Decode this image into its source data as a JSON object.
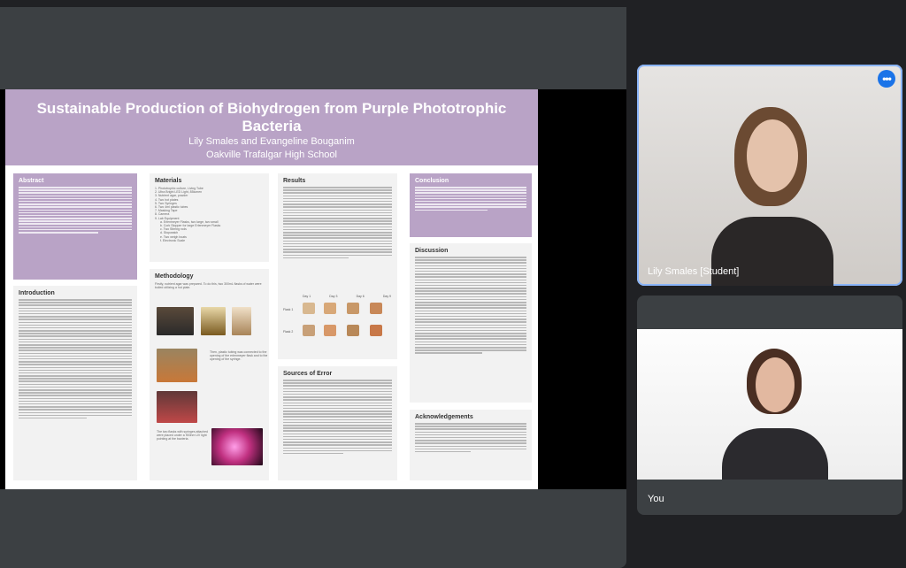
{
  "poster": {
    "title": "Sustainable Production of Biohydrogen from Purple Phototrophic Bacteria",
    "authors": "Lily Smales and Evangeline Bouganim",
    "school": "Oakville Trafalgar High School",
    "sections": {
      "abstract": "Abstract",
      "introduction": "Introduction",
      "materials": "Materials",
      "methodology": "Methodology",
      "results": "Results",
      "sources_of_error": "Sources of Error",
      "conclusion": "Conclusion",
      "discussion": "Discussion",
      "acknowledgements": "Acknowledgements"
    },
    "materials_list": [
      "1. Phototrophic culture, Living Tube",
      "2. Ultra Bright LED Light, 85lumen",
      "3. Nutrient agar, powder",
      "4. Two hot plates",
      "5. Two Syringes",
      "6. Two 4ml plastic tubes",
      "7. Masking Tape",
      "8. Camera",
      "9. Lab Equipment",
      "a. Erlenmeyer Flasks, two large, two small",
      "b. Cork Stopper for large Erlenmeyer Flasks",
      "c. Two Stirring rods",
      "d. Stopwatch",
      "e. Two weigh boats",
      "f. Electronic Scale"
    ],
    "methodology_intro": "Firstly, nutrient agar was prepared. To do this, two 300mL flasks of water were boiled utilizing a hot plate.",
    "methodology_mid": "Then, plastic tubing was connected to the opening of the erlenmeyer flask and to the opening of the syringe.",
    "methodology_end": "The two flasks with syringes attached were placed under a 900nm UV light pointing at the bacteria.",
    "results_table": {
      "col_headers": [
        "Day 1",
        "Day 3",
        "Day 6",
        "Day 9"
      ],
      "row_headers": [
        "Flask 1",
        "Flask 2"
      ]
    }
  },
  "participants": [
    {
      "name": "Lily Smales [Student]",
      "active": true,
      "menu_icon": "more-options-icon"
    },
    {
      "name": "You",
      "active": false
    }
  ],
  "colors": {
    "poster_header": "#b9a3c6",
    "active_outline": "#8ab4f8",
    "menu_button": "#1a73e8"
  }
}
